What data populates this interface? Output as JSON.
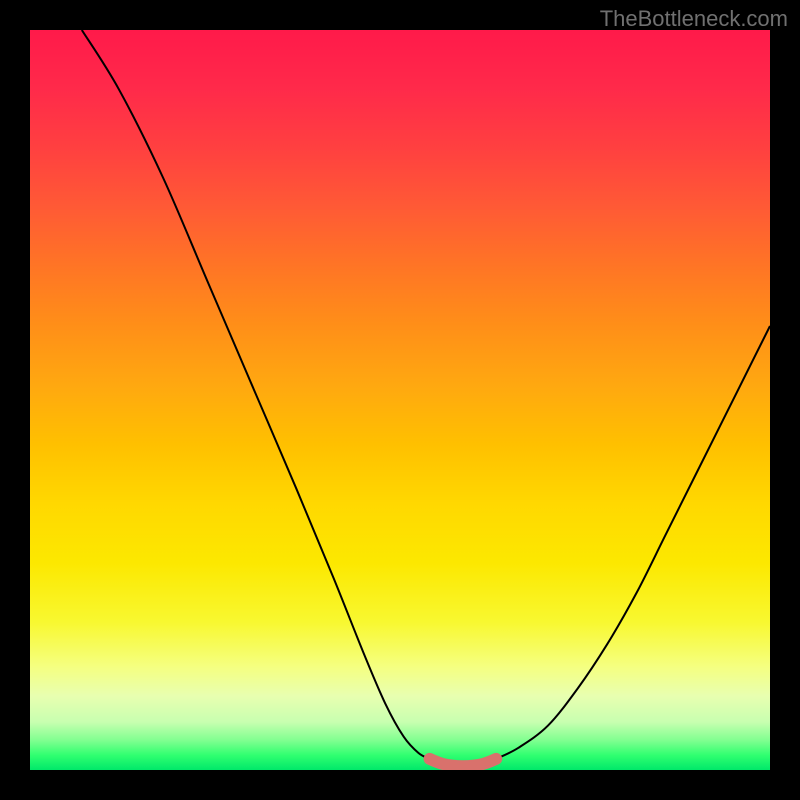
{
  "watermark": "TheBottleneck.com",
  "chart_data": {
    "type": "line",
    "title": "",
    "xlabel": "",
    "ylabel": "",
    "xlim": [
      0,
      100
    ],
    "ylim": [
      0,
      100
    ],
    "series": [
      {
        "name": "left-curve",
        "x": [
          7,
          12,
          18,
          24,
          30,
          36,
          41,
          45,
          48,
          50.5,
          52.5,
          54
        ],
        "y": [
          100,
          92,
          80,
          66,
          52,
          38,
          26,
          16,
          9,
          4.5,
          2.3,
          1.5
        ]
      },
      {
        "name": "right-curve",
        "x": [
          63,
          66,
          70,
          74,
          78,
          82,
          86,
          90,
          94,
          98,
          100
        ],
        "y": [
          1.5,
          3,
          6,
          11,
          17,
          24,
          32,
          40,
          48,
          56,
          60
        ]
      },
      {
        "name": "trough-highlight",
        "x": [
          54,
          55.5,
          57,
          58.5,
          60,
          61.5,
          63
        ],
        "y": [
          1.5,
          0.9,
          0.6,
          0.5,
          0.6,
          0.9,
          1.5
        ]
      }
    ],
    "colors": {
      "curve": "#000000",
      "trough": "#d9716c",
      "gradient_top": "#ff1a4a",
      "gradient_mid": "#ffd800",
      "gradient_bottom": "#00e86a"
    }
  }
}
